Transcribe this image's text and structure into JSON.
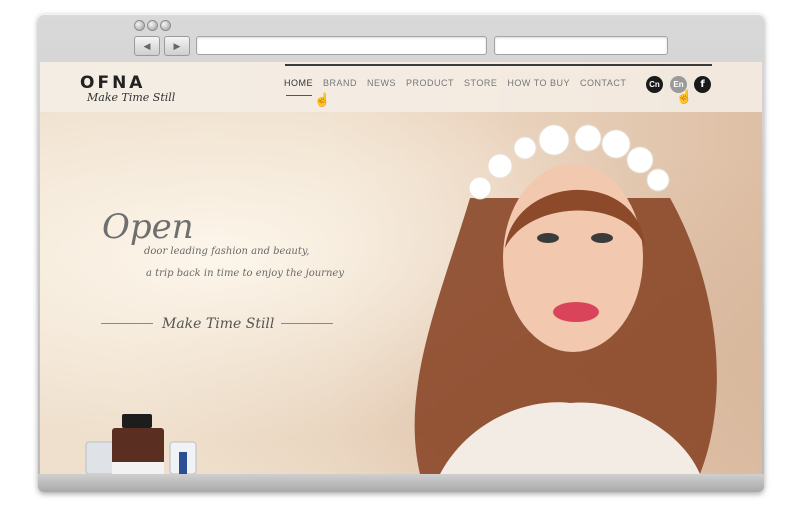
{
  "header": {
    "logo": "OFNA",
    "tagline": "Make Time Still",
    "nav": [
      "HOME",
      "BRAND",
      "NEWS",
      "PRODUCT",
      "STORE",
      "HOW TO BUY",
      "CONTACT"
    ],
    "lang_cn": "Cn",
    "lang_en": "En",
    "facebook": "f"
  },
  "hero": {
    "title": "Open",
    "line1": "door leading fashion and beauty,",
    "line2": "a trip back in time to enjoy the journey",
    "signature": "Make Time Still"
  },
  "colors": {
    "frame": "#bdbdbd",
    "hero_text": "#6f6f6f",
    "lang_dark": "#1a1a1a",
    "lang_active": "#9a9a9a",
    "lip": "#d9445a",
    "hair": "#8c4a2b"
  },
  "icons": {
    "back": "left-triangle",
    "forward": "right-triangle",
    "pointer": "hand-pointer"
  }
}
